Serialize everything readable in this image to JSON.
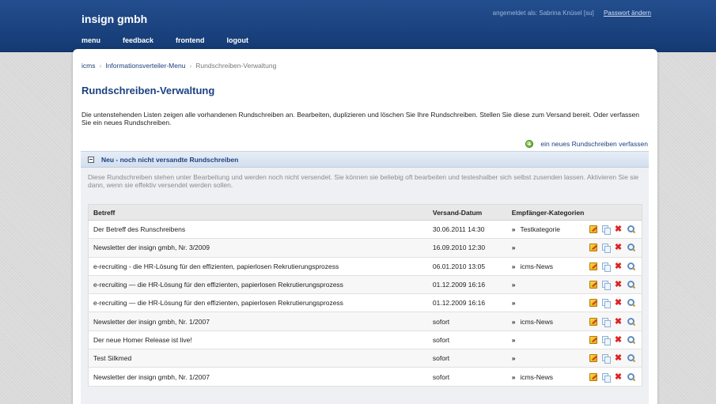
{
  "header": {
    "brand": "insign gmbh",
    "user_text": "angemeldet als: Sabrina Knüsel [su]",
    "password_link": "Passwort ändern",
    "nav": [
      "menu",
      "feedback",
      "frontend",
      "logout"
    ]
  },
  "breadcrumb": [
    "icms",
    "Informationsverteiler-Menu",
    "Rundschreiben-Verwaltung"
  ],
  "page": {
    "title": "Rundschreiben-Verwaltung",
    "intro": "Die untenstehenden Listen zeigen alle vorhandenen Rundschreiben an. Bearbeiten, duplizieren und löschen Sie Ihre Rundschreiben. Stellen Sie diese zum Versand bereit. Oder verfassen Sie ein neues Rundschreiben.",
    "new_link": "ein neues Rundschreiben verfassen"
  },
  "section": {
    "title": "Neu - noch nicht versandte Rundschreiben",
    "description": "Diese Rundschreiben stehen unter Bearbeitung und werden noch nicht versendet. Sie können sie beliebig oft bearbeiten und testeshalber sich selbst zusenden lassen. Aktivieren Sie sie dann, wenn sie effektiv versendet werden sollen.",
    "columns": [
      "Betreff",
      "Versand-Datum",
      "Empfänger-Kategorien"
    ],
    "rows": [
      {
        "subject": "Der Betreff des Runschreibens",
        "date": "30.06.2011 14:30",
        "category": "Testkategorie"
      },
      {
        "subject": "Newsletter der insign gmbh, Nr. 3/2009",
        "date": "16.09.2010 12:30",
        "category": ""
      },
      {
        "subject": "e-recruiting - die HR-Lösung für den effizienten, papierlosen Rekrutierungsprozess",
        "date": "06.01.2010 13:05",
        "category": "icms-News"
      },
      {
        "subject": "e-recruiting — die HR-Lösung für den effizienten, papierlosen Rekrutierungsprozess",
        "date": "01.12.2009 16:16",
        "category": ""
      },
      {
        "subject": "e-recruiting — die HR-Lösung für den effizienten, papierlosen Rekrutierungsprozess",
        "date": "01.12.2009 16:16",
        "category": ""
      },
      {
        "subject": "Newsletter der insign gmbh, Nr. 1/2007",
        "date": "sofort",
        "category": "icms-News"
      },
      {
        "subject": "Der neue Homer Release ist live!",
        "date": "sofort",
        "category": ""
      },
      {
        "subject": "Test Silkmed",
        "date": "sofort",
        "category": ""
      },
      {
        "subject": "Newsletter der insign gmbh, Nr. 1/2007",
        "date": "sofort",
        "category": "icms-News"
      }
    ],
    "row_actions": [
      "edit-icon",
      "copy-icon",
      "delete-icon",
      "view-icon"
    ]
  },
  "colors": {
    "header_blue": "#1b4583",
    "title_blue": "#1c4182",
    "delete_red": "#dd2222"
  }
}
